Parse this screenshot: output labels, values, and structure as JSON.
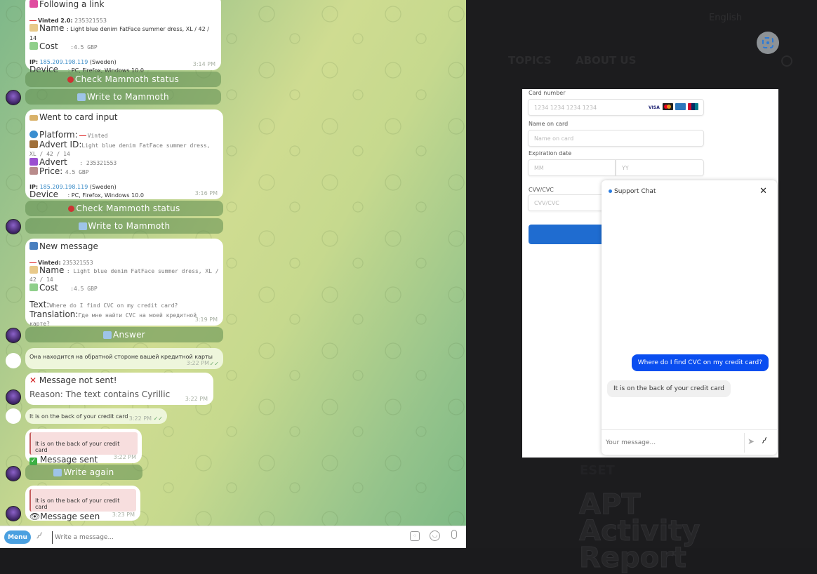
{
  "telegram": {
    "messages": [
      {
        "title": "Following a link",
        "title_icon": "shopping-bags-icon",
        "vinted_label": "Vinted 2.0:",
        "vinted_id": "235321553",
        "name_label": "Name",
        "name_value": ": Light blue denim FatFace summer dress, XL / 42 / 14",
        "cost_label": "Cost",
        "cost_value": ":4.5 GBP",
        "ip_label": "IP:",
        "ip_value": "185.209.198.119",
        "ip_country": "(Sweden)",
        "device_label": "Device",
        "device_value": ": PC, Firefox, Windows 10.0",
        "time": "3:14 PM",
        "buttons": [
          "Check Mammoth status",
          "Write to Mammoth"
        ]
      },
      {
        "title": "Went to card input",
        "title_icon": "credit-card-icon",
        "platform_label": "Platform:",
        "platform_value": "Vinted",
        "advert_id_label": "Advert ID:",
        "advert_id_value": "Light blue denim FatFace summer dress, XL / 42 / 14",
        "advert_label": "Advert",
        "advert_value": ": 235321553",
        "price_label": "Price:",
        "price_value": "4.5 GBP",
        "ip_label": "IP:",
        "ip_value": "185.209.198.119",
        "ip_country": "(Sweden)",
        "device_label": "Device",
        "device_value": ": PC, Firefox, Windows 10.0",
        "time": "3:16 PM",
        "buttons": [
          "Check Mammoth status",
          "Write to Mammoth"
        ]
      },
      {
        "title": "New message",
        "title_icon": "new-badge-icon",
        "vinted_label": "Vinted:",
        "vinted_id": "235321553",
        "name_label": "Name",
        "name_value": ": Light blue denim FatFace summer dress, XL / 42 / 14",
        "cost_label": "Cost",
        "cost_value": ":4.5 GBP",
        "text_label": "Text:",
        "text_value": "Where do I find CVC on my credit card?",
        "translation_label": "Translation:",
        "translation_value": "Где мне найти CVC на моей кредитной карте?",
        "time": "3:19 PM",
        "buttons": [
          "Answer"
        ]
      },
      {
        "text": "Она находится на обратной стороне вашей кредитной карты",
        "time": "3:22 PM"
      },
      {
        "title": "Message not sent!",
        "reason": "Reason: The text contains Cyrillic",
        "time": "3:22 PM"
      },
      {
        "text": "It is on the back of your credit card",
        "time": "3:22 PM"
      },
      {
        "quote": "It is on the back of your credit card",
        "status": "Message sent",
        "time": "3:22 PM",
        "buttons": [
          "Write again"
        ]
      },
      {
        "quote": "It is on the back of your credit card",
        "status": "Message seen",
        "time": "3:23 PM"
      }
    ],
    "input": {
      "menu_label": "Menu",
      "placeholder": "Write a message..."
    }
  },
  "website": {
    "nav": [
      "TOPICS",
      "ABOUT US"
    ],
    "top_button": "English",
    "card_form": {
      "card_number_label": "Card number",
      "card_number_placeholder": "1234 1234 1234 1234",
      "card_brands": [
        "VISA",
        "Mastercard",
        "Amex",
        "UnionPay"
      ],
      "name_label": "Name on card",
      "name_placeholder": "Name on card",
      "expiration_label": "Expiration date",
      "month_placeholder": "MM",
      "year_placeholder": "YY",
      "cvv_label": "CVV/CVC",
      "cvv_placeholder": "CVV/CVC"
    },
    "support_chat": {
      "title": "Support Chat",
      "messages": [
        {
          "from": "user",
          "text": "Where do I find CVC on my credit card?"
        },
        {
          "from": "support",
          "text": "It is on the back of your credit card"
        }
      ],
      "input_placeholder": "Your message..."
    },
    "background_logo": "ESET",
    "background_heading": "APT Activity Report",
    "colors": {
      "chat_user_bubble": "#0a4ef0",
      "pay_button": "#1f6cd0",
      "menu_button": "#4aa0e0"
    }
  }
}
